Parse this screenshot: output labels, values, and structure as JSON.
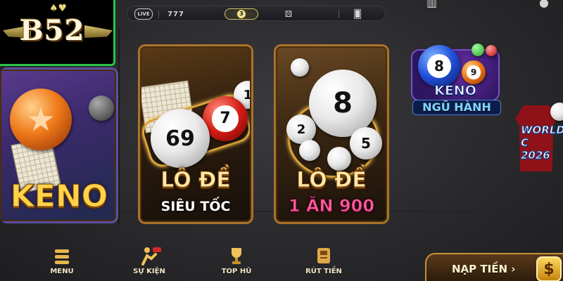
{
  "logo": {
    "text": "B52"
  },
  "categories": {
    "live": "LIVE",
    "slots": "777",
    "lotto": "3"
  },
  "games": {
    "keno": {
      "title": "KENO"
    },
    "lode_sieu_toc": {
      "title": "LÔ ĐỀ",
      "subtitle": "SIÊU TỐC",
      "ball_main": "69",
      "ball_red": "7"
    },
    "lode_1an900": {
      "title": "LÔ ĐỀ",
      "subtitle": "1 ĂN 900",
      "ball_main": "8",
      "ball_a": "2",
      "ball_b": "5"
    },
    "keno_ngu_hanh": {
      "title": "KENO",
      "subtitle": "NGŨ HÀNH",
      "ball_blue": "8",
      "ball_orange": "9"
    }
  },
  "poster": {
    "line1": "WORLD C",
    "line2": "2026"
  },
  "nav": {
    "menu": "MENU",
    "events": "SỰ KIỆN",
    "jackpot": "TOP HŨ",
    "withdraw": "RÚT TIỀN"
  },
  "deposit": {
    "label": "NẠP TIỀN ›",
    "icon_text": "$"
  },
  "colors": {
    "accent_green": "#2bc24a",
    "frame_gold": "#a8742c",
    "title_gold": "#ffe9a8",
    "pink": "#ff5c9c"
  }
}
